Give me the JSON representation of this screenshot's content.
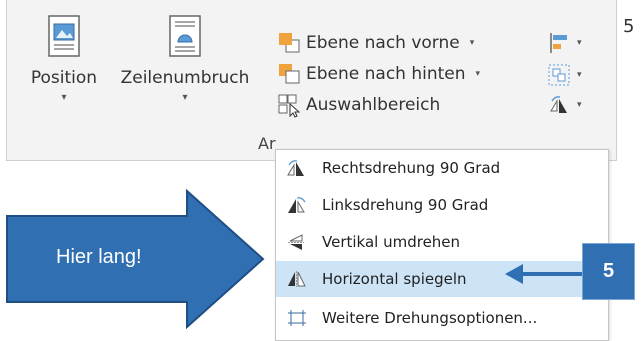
{
  "ribbon": {
    "position_label": "Position",
    "wrap_label": "Zeilenumbruch",
    "bring_forward_label": "Ebene nach vorne",
    "send_backward_label": "Ebene nach hinten",
    "selection_pane_label": "Auswahlbereich",
    "group_label_partial": "Ar",
    "caret": "▾"
  },
  "stray_number": "5",
  "rotate_menu": {
    "items": [
      {
        "label": "Rechtsdrehung 90 Grad",
        "icon": "rotate-right-icon",
        "highlighted": false
      },
      {
        "label": "Linksdrehung 90 Grad",
        "icon": "rotate-left-icon",
        "highlighted": false
      },
      {
        "label": "Vertikal umdrehen",
        "icon": "flip-vertical-icon",
        "highlighted": false
      },
      {
        "label": "Horizontal spiegeln",
        "icon": "flip-horizontal-icon",
        "highlighted": true
      },
      {
        "label": "Weitere Drehungsoptionen...",
        "icon": "more-rotation-options-icon",
        "highlighted": false
      }
    ]
  },
  "callout": {
    "arrow_text": "Hier lang!",
    "step_badge": "5"
  },
  "colors": {
    "accent_blue": "#2f6fb2",
    "highlight": "#cde4f7",
    "arrow_blue": "#2f6fb2",
    "icon_orange": "#f0a33c"
  }
}
